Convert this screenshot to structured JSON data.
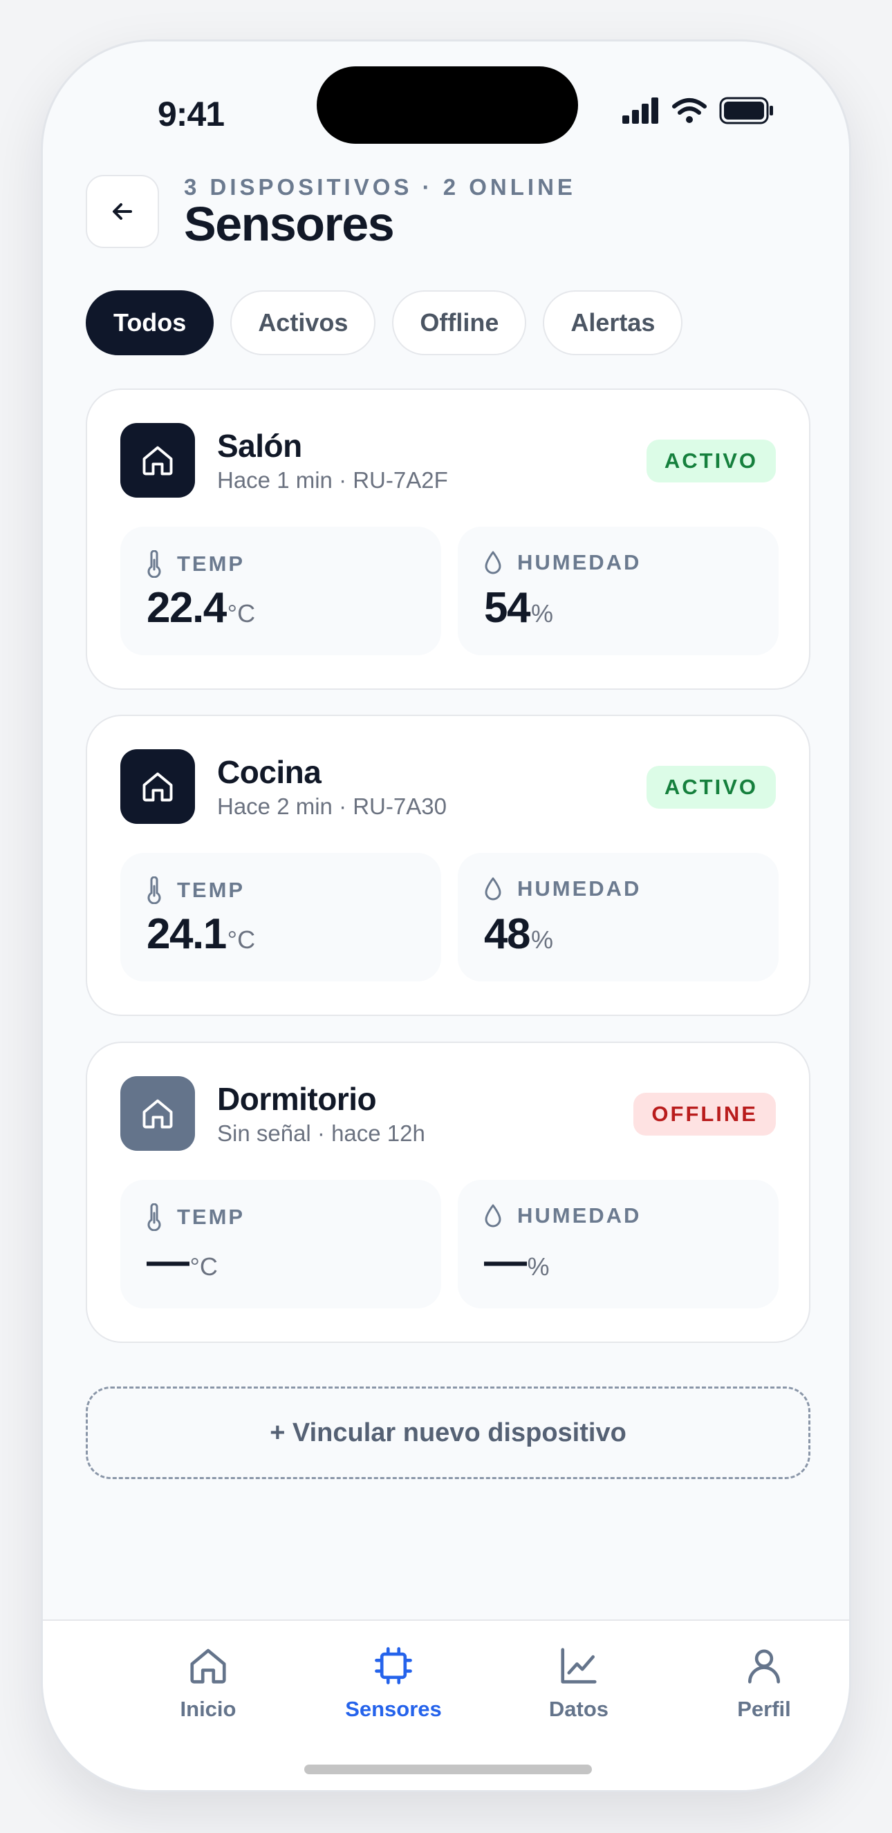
{
  "status": {
    "time": "9:41"
  },
  "header": {
    "eyebrow": "3 DISPOSITIVOS · 2 ONLINE",
    "title": "Sensores"
  },
  "filters": [
    {
      "label": "Todos",
      "active": true
    },
    {
      "label": "Activos",
      "active": false
    },
    {
      "label": "Offline",
      "active": false
    },
    {
      "label": "Alertas",
      "active": false
    }
  ],
  "labels": {
    "temp": "TEMP",
    "humidity": "HUMEDAD"
  },
  "devices": [
    {
      "name": "Salón",
      "meta": "Hace 1 min · RU-7A2F",
      "status": "ACTIVO",
      "temp": "22.4",
      "temp_unit": "°C",
      "humidity": "54",
      "humidity_unit": "%"
    },
    {
      "name": "Cocina",
      "meta": "Hace 2 min · RU-7A30",
      "status": "ACTIVO",
      "temp": "24.1",
      "temp_unit": "°C",
      "humidity": "48",
      "humidity_unit": "%"
    },
    {
      "name": "Dormitorio",
      "meta": "Sin señal · hace 12h",
      "status": "OFFLINE",
      "temp": "—",
      "temp_unit": "°C",
      "humidity": "—",
      "humidity_unit": "%"
    }
  ],
  "add_device_label": "+ Vincular nuevo dispositivo",
  "nav": [
    {
      "label": "Inicio",
      "icon": "home-icon"
    },
    {
      "label": "Sensores",
      "icon": "chip-icon"
    },
    {
      "label": "Datos",
      "icon": "chart-icon"
    },
    {
      "label": "Perfil",
      "icon": "user-icon"
    }
  ],
  "colors": {
    "primary": "#0f172a",
    "accent": "#2563eb",
    "active_bg": "#dcfce7",
    "active_fg": "#15803d",
    "offline_bg": "#fee2e2",
    "offline_fg": "#b91c1c"
  }
}
